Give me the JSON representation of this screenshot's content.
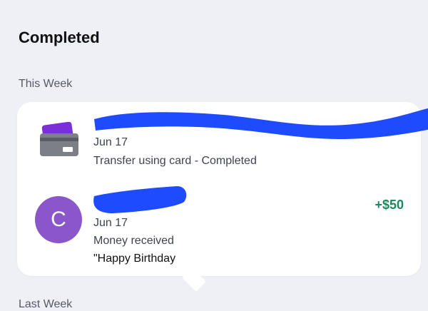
{
  "page": {
    "title": "Completed"
  },
  "groups": {
    "this_week": "This Week",
    "last_week": "Last Week"
  },
  "transactions": [
    {
      "icon": "card-icon",
      "date": "Jun 17",
      "description": "Transfer using card - Completed"
    },
    {
      "icon": "avatar",
      "avatar_initial": "C",
      "avatar_color": "#8a56c9",
      "amount": "+$50",
      "amount_color": "#1a8a5c",
      "date": "Jun 17",
      "description": "Money received",
      "note": "\"Happy Birthday"
    }
  ],
  "colors": {
    "background": "#eff0f6",
    "redaction": "#1f4bff"
  }
}
